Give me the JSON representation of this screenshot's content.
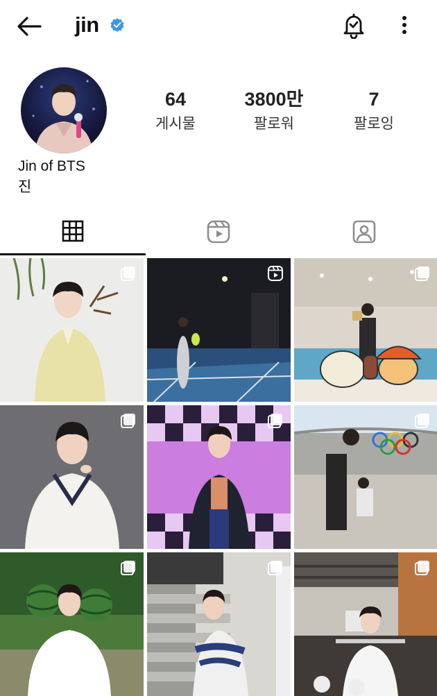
{
  "header": {
    "username": "jin",
    "verified": true,
    "icons": {
      "back": "back-arrow-icon",
      "verified": "verified-badge-icon",
      "notifications": "bell-check-icon",
      "more": "more-vertical-icon"
    }
  },
  "profile": {
    "display_name": "Jin of BTS",
    "bio": "진",
    "stats": [
      {
        "value": "64",
        "label": "게시물"
      },
      {
        "value": "3800만",
        "label": "팔로워"
      },
      {
        "value": "7",
        "label": "팔로잉"
      }
    ]
  },
  "tabs": [
    {
      "name": "posts",
      "icon": "grid-icon",
      "selected": true
    },
    {
      "name": "reels",
      "icon": "reels-icon",
      "selected": false
    },
    {
      "name": "tagged",
      "icon": "tagged-person-icon",
      "selected": false
    }
  ],
  "colors": {
    "verified_blue": "#3897f0",
    "text": "#111111",
    "icon_gray": "#8e8e8e"
  },
  "posts": [
    {
      "type": "carousel",
      "badge_icon": "carousel-icon"
    },
    {
      "type": "reel",
      "badge_icon": "reels-icon"
    },
    {
      "type": "carousel",
      "badge_icon": "carousel-icon"
    },
    {
      "type": "carousel",
      "badge_icon": "carousel-icon"
    },
    {
      "type": "carousel",
      "badge_icon": "carousel-icon"
    },
    {
      "type": "carousel",
      "badge_icon": "carousel-icon"
    },
    {
      "type": "carousel",
      "badge_icon": "carousel-icon"
    },
    {
      "type": "carousel",
      "badge_icon": "carousel-icon"
    },
    {
      "type": "carousel",
      "badge_icon": "carousel-icon"
    }
  ]
}
